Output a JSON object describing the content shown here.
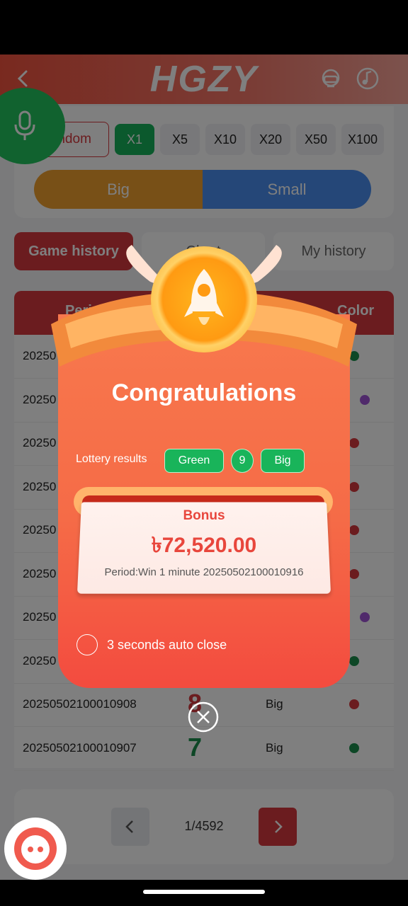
{
  "app": {
    "logo": "HGZY"
  },
  "bet_panel": {
    "random_label": "Random",
    "multipliers": [
      "X1",
      "X5",
      "X10",
      "X20",
      "X50",
      "X100"
    ],
    "big_label": "Big",
    "small_label": "Small"
  },
  "tabs": {
    "game_history": "Game history",
    "chart": "Chart",
    "my_history": "My history"
  },
  "table": {
    "headers": {
      "period": "Period",
      "color": "Color"
    },
    "rows": [
      {
        "period": "20250",
        "color": "#1a8f4c"
      },
      {
        "period": "20250",
        "color": "#a155d6"
      },
      {
        "period": "20250",
        "color": "#d6393e"
      },
      {
        "period": "20250",
        "color": "#d6393e"
      },
      {
        "period": "20250",
        "color": "#d6393e"
      },
      {
        "period": "20250",
        "color": "#d6393e"
      },
      {
        "period": "20250",
        "color": "#a155d6"
      },
      {
        "period": "20250",
        "color": "#1a8f4c"
      },
      {
        "period": "20250502100010908",
        "number": "8",
        "size": "Big",
        "color": "#d6393e"
      },
      {
        "period": "20250502100010907",
        "number": "7",
        "size": "Big",
        "color": "#1a8f4c"
      }
    ]
  },
  "pagination": {
    "page": "1/4592"
  },
  "popup": {
    "title": "Congratulations",
    "lottery_label": "Lottery results",
    "result_color": "Green",
    "result_number": "9",
    "result_size": "Big",
    "bonus_label": "Bonus",
    "bonus_amount": "৳72,520.00",
    "period_text": "Period:Win 1 minute 20250502100010916",
    "auto_close": "3 seconds auto close"
  },
  "colors": {
    "accent": "#f3533f",
    "green": "#19b45a",
    "red": "#d6393e",
    "violet": "#a155d6",
    "big": "#f0a12e",
    "small": "#4a8ff0"
  }
}
